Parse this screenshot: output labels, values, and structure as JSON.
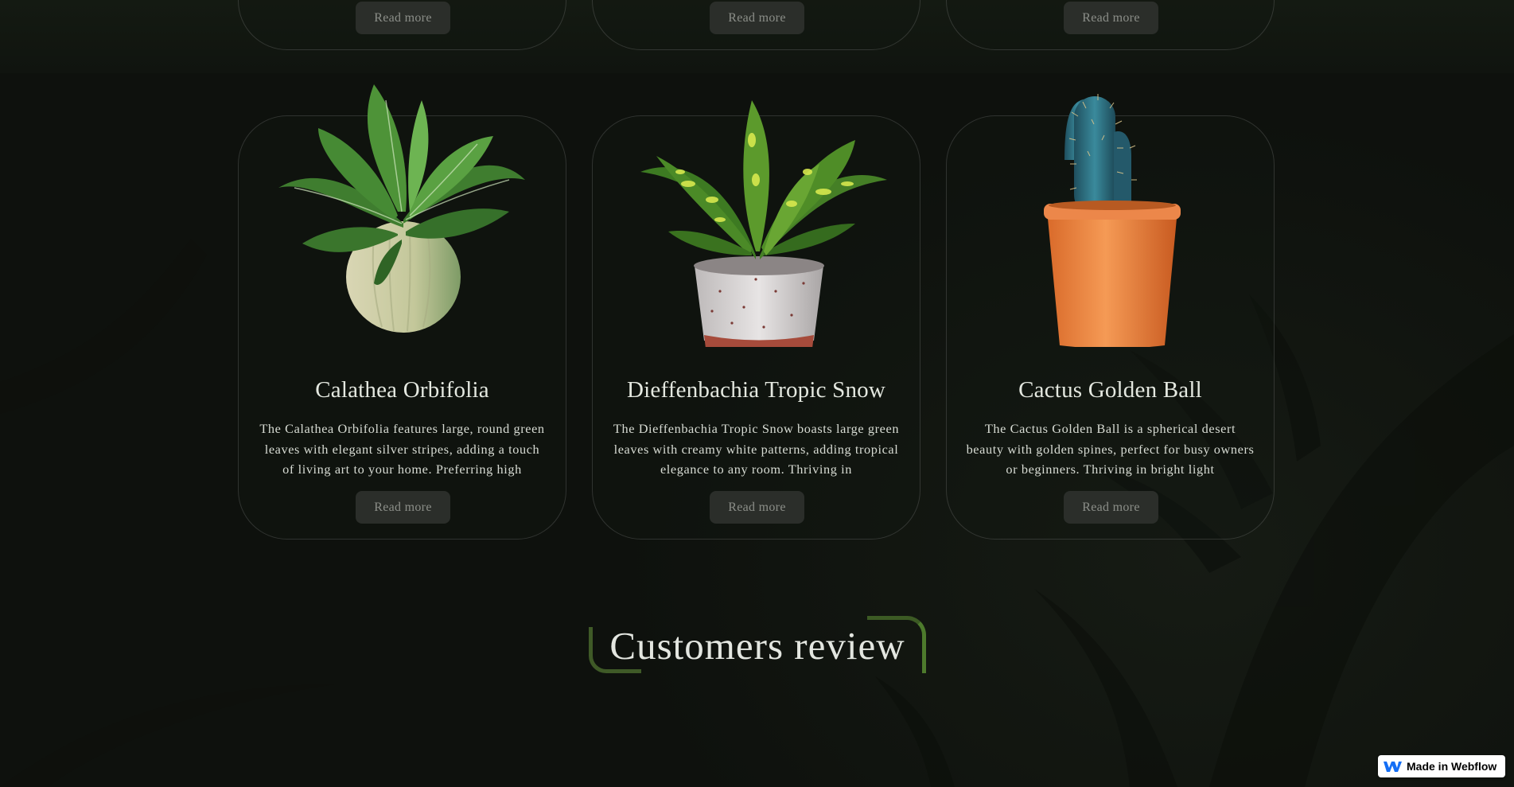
{
  "colors": {
    "background": "#121611",
    "card_border": "#2a3028",
    "button_bg": "#2b2e2a",
    "button_text": "#8b8e88",
    "title_accent_green": "#4d7a2c",
    "webflow_blue": "#146EF5"
  },
  "top_row": {
    "buttons": [
      {
        "label": "Read more"
      },
      {
        "label": "Read more"
      },
      {
        "label": "Read more"
      }
    ]
  },
  "products": [
    {
      "image_icon": "calathea-plant-image",
      "name": "Calathea Orbifolia",
      "description": "The Calathea Orbifolia features large, round green leaves with elegant silver stripes, adding a touch of living art to your home. Preferring high",
      "button_label": "Read more"
    },
    {
      "image_icon": "dieffenbachia-plant-image",
      "name": "Dieffenbachia Tropic Snow",
      "description": "The Dieffenbachia Tropic Snow boasts large green leaves with creamy white patterns, adding tropical elegance to any room. Thriving in",
      "button_label": "Read more"
    },
    {
      "image_icon": "cactus-plant-image",
      "name": "Cactus Golden Ball",
      "description": "The Cactus Golden Ball is a spherical desert beauty with golden spines, perfect for busy owners or beginners. Thriving in bright light",
      "button_label": "Read more"
    }
  ],
  "reviews_section": {
    "title": "Customers review"
  },
  "webflow_badge": {
    "icon": "webflow-logo-icon",
    "label": "Made in Webflow"
  }
}
